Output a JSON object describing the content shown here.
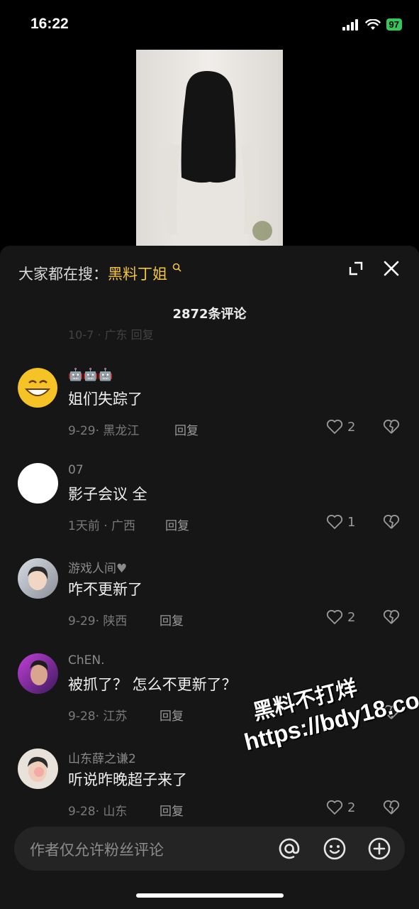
{
  "status_bar": {
    "time": "16:22",
    "battery": "97"
  },
  "header": {
    "search_prefix": "大家都在搜：",
    "search_keyword": "黑料丁姐",
    "comment_count": "2872条评论"
  },
  "faded_row": "10-7 · 广东   回复",
  "comments": [
    {
      "username": "🤖🤖🤖",
      "text": "姐们失踪了",
      "meta": "9-29· 黑龙江",
      "reply": "回复",
      "likes": "2"
    },
    {
      "username": "07",
      "text": "影子会议 全",
      "meta": "1天前 · 广西",
      "reply": "回复",
      "likes": "1"
    },
    {
      "username": "游戏人间♥",
      "text": "咋不更新了",
      "meta": "9-29· 陕西",
      "reply": "回复",
      "likes": "2"
    },
    {
      "username": "ChEN.",
      "text": "被抓了？ 怎么不更新了？",
      "meta": "9-28· 江苏",
      "reply": "回复",
      "likes": ""
    },
    {
      "username": "山东薛之谦2",
      "text": "听说昨晚超子来了",
      "meta": "9-28· 山东",
      "reply": "回复",
      "likes": "2"
    }
  ],
  "input": {
    "placeholder": "作者仅允许粉丝评论"
  },
  "watermark": {
    "line1": "黑料不打烊",
    "line2": "https://bdy18.co"
  },
  "colors": {
    "keyword": "#f3c440",
    "battery": "#34c759",
    "sheet_bg": "#161616"
  }
}
